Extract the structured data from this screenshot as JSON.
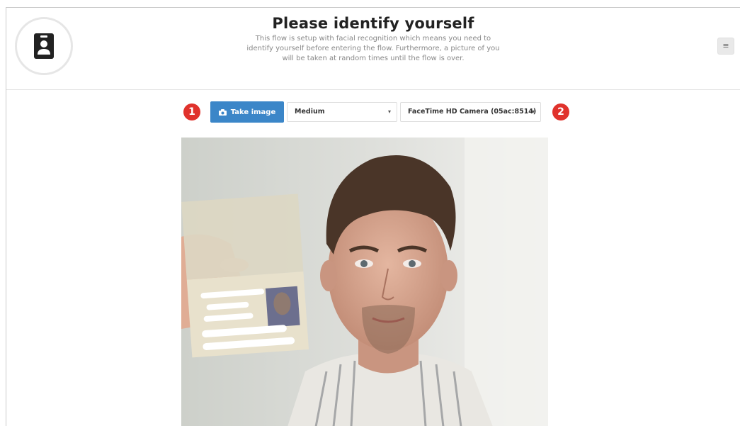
{
  "header": {
    "title": "Please identify yourself",
    "description": "This flow is setup with facial recognition which means you need to identify yourself before entering the flow. Furthermore, a picture of you will be taken at random times until the flow is over.",
    "menu_icon": "≡"
  },
  "toolbar": {
    "marker_1": "1",
    "marker_2": "2",
    "take_image_label": "Take image",
    "quality_select": "Medium",
    "camera_select": "FaceTime HD Camera (05ac:8514)"
  },
  "icons": {
    "avatar": "id-badge-icon",
    "camera": "camera-icon",
    "menu": "hamburger-menu-icon"
  },
  "colors": {
    "primary_button": "#3b86c8",
    "marker": "#e0322c"
  }
}
